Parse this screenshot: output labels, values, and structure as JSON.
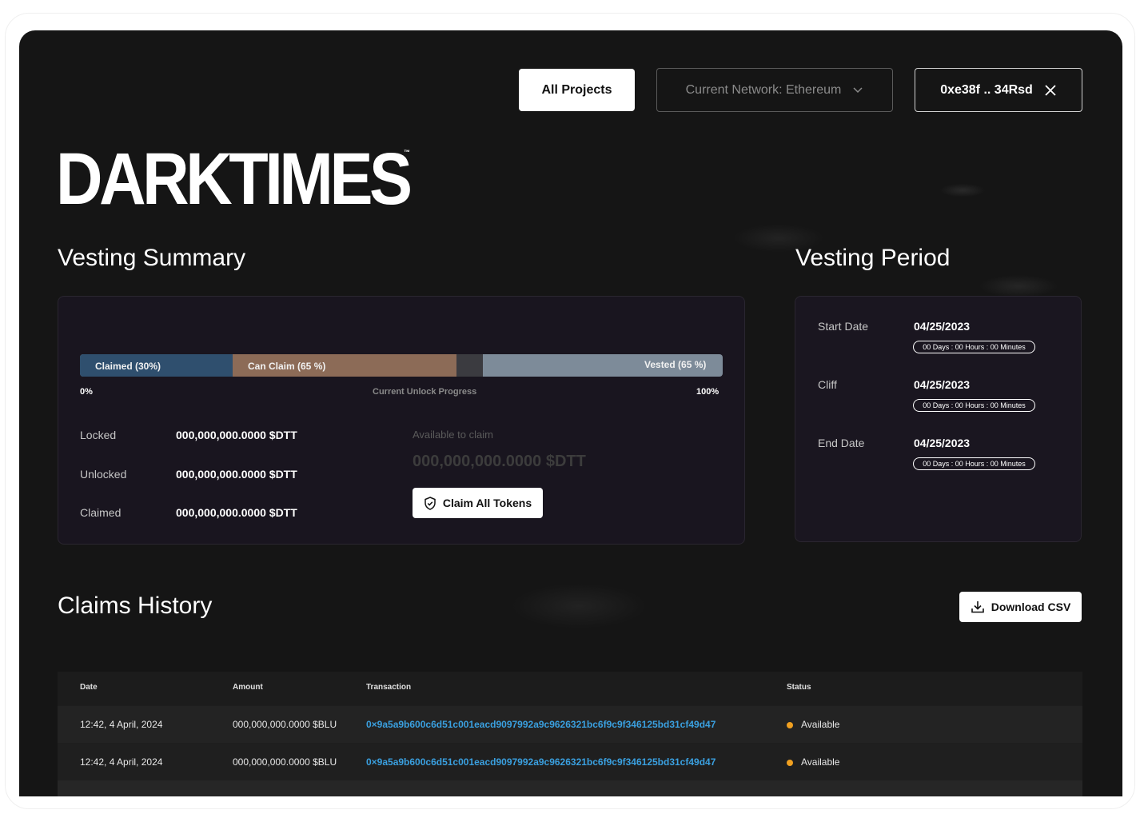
{
  "header": {
    "all_projects": "All Projects",
    "network": "Current Network: Ethereum",
    "wallet": "0xe38f .. 34Rsd"
  },
  "brand": {
    "logo_text": "DARKTIMES",
    "tm": "™"
  },
  "vesting_summary": {
    "title": "Vesting Summary",
    "progress": {
      "claimed_label": "Claimed (30%)",
      "can_claim_label": "Can Claim (65 %)",
      "vested_label": "Vested (65 %)",
      "start": "0%",
      "caption": "Current Unlock Progress",
      "end": "100%"
    },
    "rows": [
      {
        "label": "Locked",
        "value": "000,000,000.0000 $DTT"
      },
      {
        "label": "Unlocked",
        "value": "000,000,000.0000 $DTT"
      },
      {
        "label": "Claimed",
        "value": "000,000,000.0000 $DTT"
      }
    ],
    "available_label": "Available to claim",
    "available_value": "000,000,000.0000 $DTT",
    "claim_button": "Claim All Tokens"
  },
  "vesting_period": {
    "title": "Vesting Period",
    "items": [
      {
        "label": "Start Date",
        "date": "04/25/2023",
        "countdown": "00 Days : 00 Hours : 00 Minutes"
      },
      {
        "label": "Cliff",
        "date": "04/25/2023",
        "countdown": "00 Days : 00 Hours : 00 Minutes"
      },
      {
        "label": "End Date",
        "date": "04/25/2023",
        "countdown": "00 Days : 00 Hours : 00 Minutes"
      }
    ]
  },
  "claims_history": {
    "title": "Claims History",
    "download": "Download CSV",
    "columns": [
      "Date",
      "Amount",
      "Transaction",
      "Status"
    ],
    "rows": [
      {
        "date": "12:42, 4 April, 2024",
        "amount": "000,000,000.0000 $BLU",
        "tx": "0×9a5a9b600c6d51c001eacd9097992a9c9626321bc6f9c9f346125bd31cf49d47",
        "status": "Available"
      },
      {
        "date": "12:42, 4 April, 2024",
        "amount": "000,000,000.0000 $BLU",
        "tx": "0×9a5a9b600c6d51c001eacd9097992a9c9626321bc6f9c9f346125bd31cf49d47",
        "status": "Available"
      }
    ]
  },
  "colors": {
    "accent_link": "#3aa0e0",
    "status_available": "#f0a020"
  }
}
